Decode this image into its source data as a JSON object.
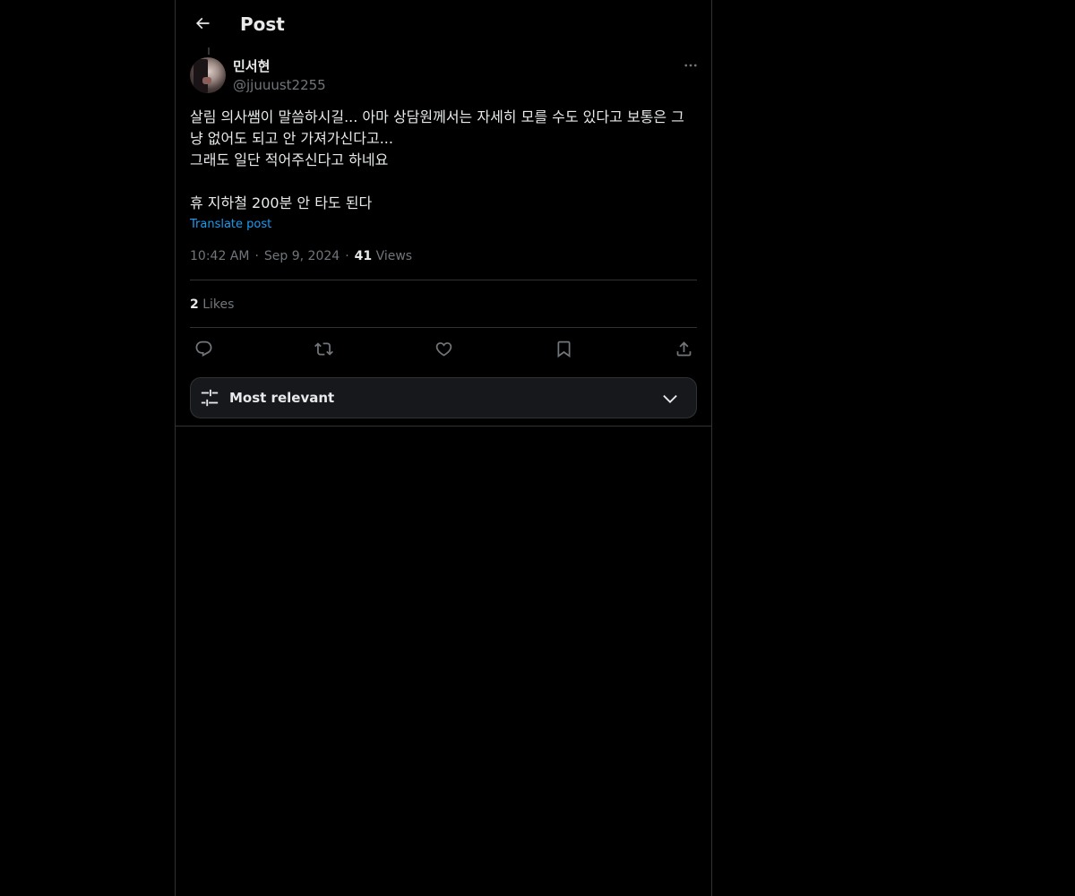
{
  "header": {
    "title": "Post"
  },
  "post": {
    "author": {
      "display_name": "민서현",
      "handle": "@jjuuust2255"
    },
    "text": "살림 의사쌤이 말씀하시길... 아마 상담원께서는 자세히 모를 수도 있다고 보통은 그냥 없어도 되고 안 가져가신다고...\n그래도 일단 적어주신다고 하네요\n\n휴 지하철 200분 안 타도 된다",
    "translate_label": "Translate post",
    "time": "10:42 AM",
    "date": "Sep 9, 2024",
    "separator": "·",
    "views_count": "41",
    "views_label": "Views",
    "likes_count": "2",
    "likes_label": "Likes"
  },
  "actions": [
    {
      "name": "reply",
      "icon": "reply-icon"
    },
    {
      "name": "repost",
      "icon": "repost-icon"
    },
    {
      "name": "like",
      "icon": "heart-icon"
    },
    {
      "name": "bookmark",
      "icon": "bookmark-icon"
    },
    {
      "name": "share",
      "icon": "share-icon"
    }
  ],
  "replies_sort": {
    "label": "Most relevant",
    "icon": "sliders-icon"
  },
  "colors": {
    "background": "#000000",
    "text_primary": "#e7e9ea",
    "text_secondary": "#71767b",
    "accent": "#1d9bf0",
    "border": "#2f3336"
  }
}
